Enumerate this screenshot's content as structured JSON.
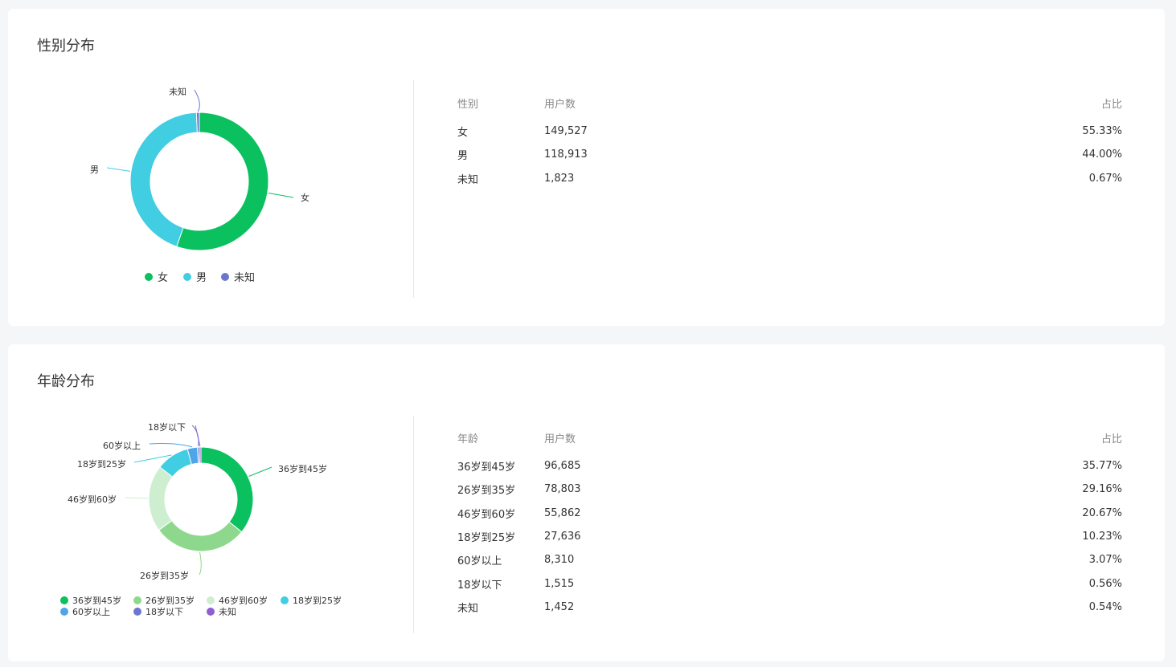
{
  "gender": {
    "title": "性别分布",
    "table": {
      "headers": [
        "性别",
        "用户数",
        "占比"
      ],
      "rows": [
        {
          "label": "女",
          "count": "149,527",
          "pct": "55.33%"
        },
        {
          "label": "男",
          "count": "118,913",
          "pct": "44.00%"
        },
        {
          "label": "未知",
          "count": "1,823",
          "pct": "0.67%"
        }
      ]
    }
  },
  "age": {
    "title": "年龄分布",
    "table": {
      "headers": [
        "年龄",
        "用户数",
        "占比"
      ],
      "rows": [
        {
          "label": "36岁到45岁",
          "count": "96,685",
          "pct": "35.77%"
        },
        {
          "label": "26岁到35岁",
          "count": "78,803",
          "pct": "29.16%"
        },
        {
          "label": "46岁到60岁",
          "count": "55,862",
          "pct": "20.67%"
        },
        {
          "label": "18岁到25岁",
          "count": "27,636",
          "pct": "10.23%"
        },
        {
          "label": "60岁以上",
          "count": "8,310",
          "pct": "3.07%"
        },
        {
          "label": "18岁以下",
          "count": "1,515",
          "pct": "0.56%"
        },
        {
          "label": "未知",
          "count": "1,452",
          "pct": "0.54%"
        }
      ]
    }
  },
  "chart_data": [
    {
      "type": "pie",
      "title": "性别分布",
      "donut": true,
      "legend": "bottom",
      "categories": [
        "女",
        "男",
        "未知"
      ],
      "values": [
        149527,
        118913,
        1823
      ],
      "colors": [
        "#0ac05f",
        "#41cde2",
        "#6b77cf"
      ]
    },
    {
      "type": "pie",
      "title": "年龄分布",
      "donut": true,
      "legend": "bottom",
      "categories": [
        "36岁到45岁",
        "26岁到35岁",
        "46岁到60岁",
        "18岁到25岁",
        "60岁以上",
        "18岁以下",
        "未知"
      ],
      "values": [
        96685,
        78803,
        55862,
        27636,
        8310,
        1515,
        1452
      ],
      "colors": [
        "#0ac05f",
        "#8ed88e",
        "#cdefd0",
        "#41cde2",
        "#4ea5e8",
        "#6b77cf",
        "#8d5fcf"
      ]
    }
  ]
}
